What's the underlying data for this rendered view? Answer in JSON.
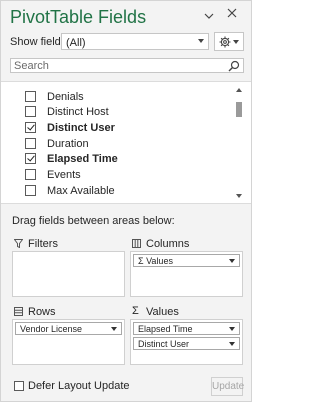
{
  "pane": {
    "title": "PivotTable Fields",
    "show_fields_label": "Show fields:",
    "show_fields_value": "(All)"
  },
  "search": {
    "placeholder": "Search"
  },
  "fields": [
    {
      "name": "Denials",
      "checked": false
    },
    {
      "name": "Distinct Host",
      "checked": false
    },
    {
      "name": "Distinct User",
      "checked": true
    },
    {
      "name": "Duration",
      "checked": false
    },
    {
      "name": "Elapsed Time",
      "checked": true
    },
    {
      "name": "Events",
      "checked": false
    },
    {
      "name": "Max Available",
      "checked": false
    }
  ],
  "areas": {
    "instruction": "Drag fields between areas below:",
    "filters": {
      "label": "Filters",
      "items": []
    },
    "columns": {
      "label": "Columns",
      "items": [
        "Values"
      ]
    },
    "rows": {
      "label": "Rows",
      "items": [
        "Vendor License"
      ]
    },
    "values": {
      "label": "Values",
      "items": [
        "Elapsed Time",
        "Distinct User"
      ]
    }
  },
  "footer": {
    "defer_label": "Defer Layout Update",
    "defer_checked": false,
    "update_label": "Update"
  },
  "icons": {
    "dropdown": "chevron-down-icon",
    "close": "close-icon",
    "settings": "gear-icon",
    "search": "search-icon",
    "filter": "filter-icon",
    "columns": "columns-icon",
    "rows": "rows-icon",
    "values": "sigma-icon"
  },
  "colors": {
    "accent": "#217346"
  }
}
